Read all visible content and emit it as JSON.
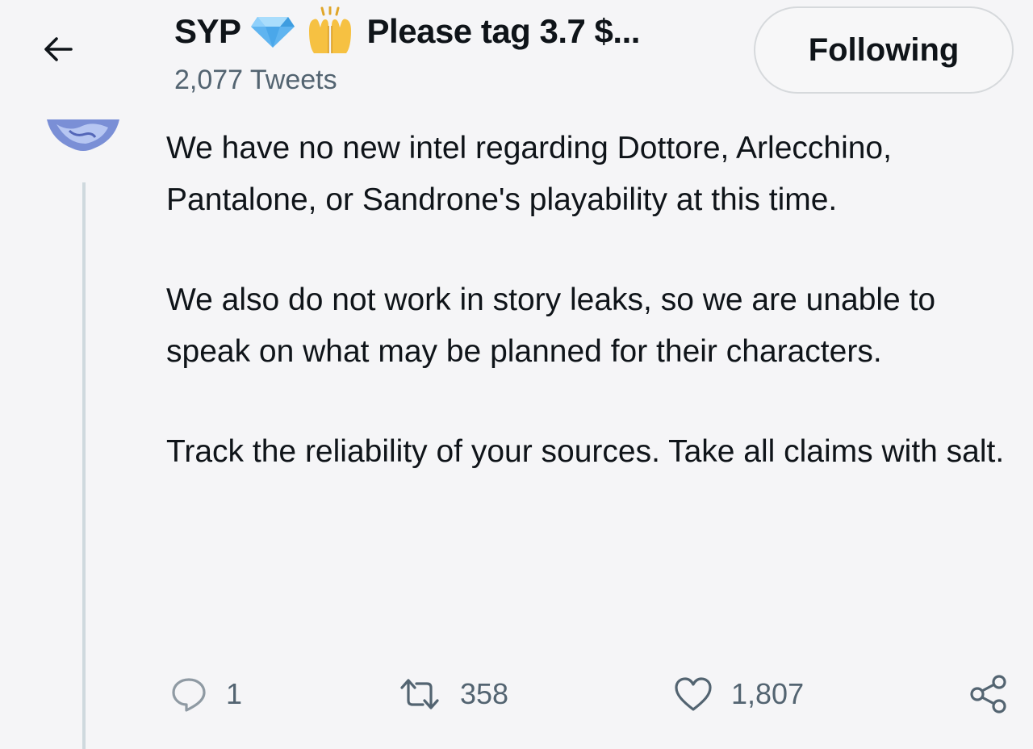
{
  "header": {
    "display_name": "SYP",
    "name_suffix": "Please tag 3.7 $...",
    "tweet_count": "2,077 Tweets",
    "follow_label": "Following",
    "name_emoji": [
      "gem-icon",
      "raising-hands-icon"
    ]
  },
  "tweet": {
    "paragraphs": [
      "We have no new intel regarding Dottore, Arlecchino, Pantalone, or Sandrone's playability at this time.",
      "We also do not work in story leaks, so we are unable to speak on what may be planned for their characters.",
      "Track the reliability of your sources. Take all claims with salt."
    ]
  },
  "actions": {
    "reply_count": "1",
    "retweet_count": "358",
    "like_count": "1,807"
  },
  "icons": {
    "back": "arrow-left-icon",
    "reply": "speech-bubble-icon",
    "retweet": "retweet-icon",
    "like": "heart-icon",
    "share": "share-icon"
  },
  "colors": {
    "background": "#f5f5f7",
    "text": "#0f1419",
    "secondary_text": "#536471",
    "thread_line": "#cfd9de"
  }
}
